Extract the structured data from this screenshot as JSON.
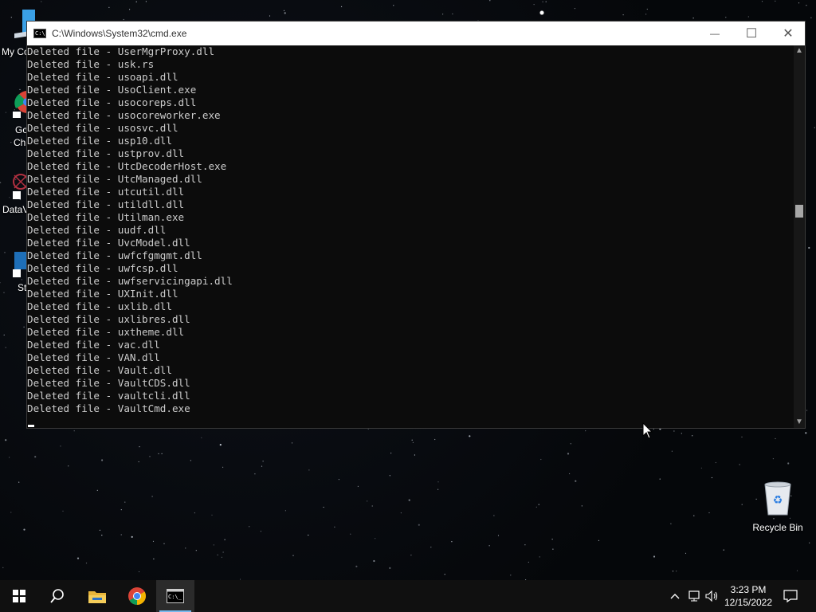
{
  "window": {
    "title": "C:\\Windows\\System32\\cmd.exe",
    "minimize_glyph": "—",
    "maximize_glyph": "☐",
    "close_glyph": "✕"
  },
  "console": {
    "lines": [
      "Deleted file - UserMgrProxy.dll",
      "Deleted file - usk.rs",
      "Deleted file - usoapi.dll",
      "Deleted file - UsoClient.exe",
      "Deleted file - usocoreps.dll",
      "Deleted file - usocoreworker.exe",
      "Deleted file - usosvc.dll",
      "Deleted file - usp10.dll",
      "Deleted file - ustprov.dll",
      "Deleted file - UtcDecoderHost.exe",
      "Deleted file - UtcManaged.dll",
      "Deleted file - utcutil.dll",
      "Deleted file - utildll.dll",
      "Deleted file - Utilman.exe",
      "Deleted file - uudf.dll",
      "Deleted file - UvcModel.dll",
      "Deleted file - uwfcfgmgmt.dll",
      "Deleted file - uwfcsp.dll",
      "Deleted file - uwfservicingapi.dll",
      "Deleted file - UXInit.dll",
      "Deleted file - uxlib.dll",
      "Deleted file - uxlibres.dll",
      "Deleted file - uxtheme.dll",
      "Deleted file - vac.dll",
      "Deleted file - VAN.dll",
      "Deleted file - Vault.dll",
      "Deleted file - VaultCDS.dll",
      "Deleted file - vaultcli.dll",
      "Deleted file - VaultCmd.exe"
    ]
  },
  "desktop": {
    "left_labels": [
      "My Co",
      "Go",
      "Ch",
      "DataV",
      "St"
    ],
    "recycle_bin": "Recycle Bin"
  },
  "taskbar": {
    "time": "3:23 PM",
    "date": "12/15/2022",
    "icons": [
      "windows-start-icon",
      "search-icon",
      "file-explorer-icon",
      "chrome-icon",
      "cmd-icon"
    ]
  },
  "colors": {
    "console_bg": "#0c0c0c",
    "console_fg": "#cccccc",
    "taskbar_bg": "#101010",
    "accent": "#76b9ed"
  }
}
